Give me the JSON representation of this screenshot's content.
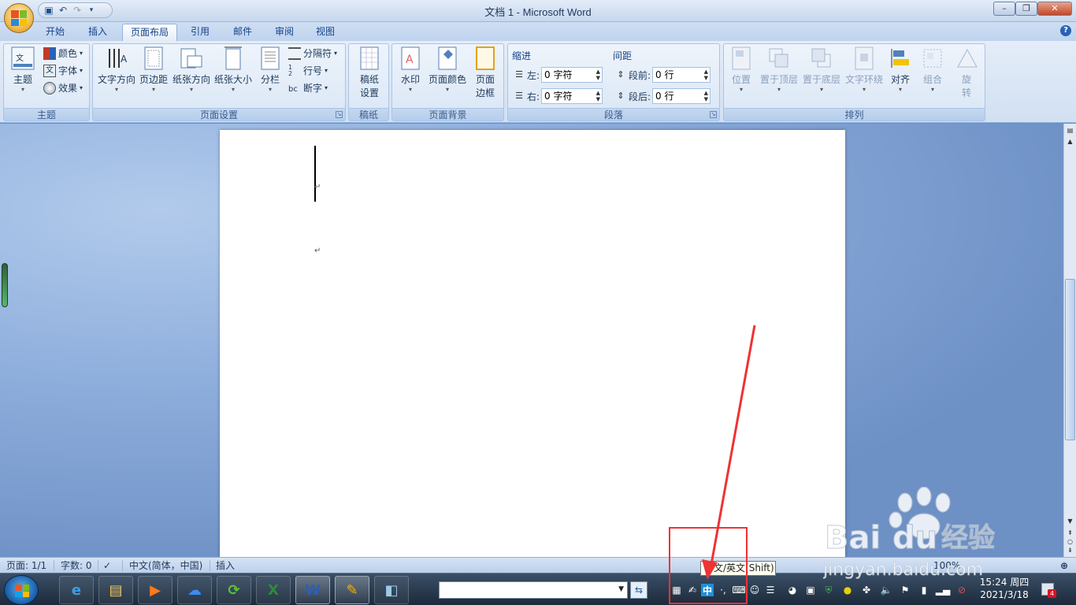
{
  "window": {
    "title": "文档 1 - Microsoft Word",
    "controls": [
      "–",
      "❐",
      "✕"
    ]
  },
  "qat": {
    "icons": [
      "save-icon",
      "undo-icon",
      "redo-icon",
      "customize-icon"
    ]
  },
  "tabs": [
    {
      "label": "开始",
      "active": false
    },
    {
      "label": "插入",
      "active": false
    },
    {
      "label": "页面布局",
      "active": true
    },
    {
      "label": "引用",
      "active": false
    },
    {
      "label": "邮件",
      "active": false
    },
    {
      "label": "审阅",
      "active": false
    },
    {
      "label": "视图",
      "active": false
    }
  ],
  "help": "?",
  "ribbon": {
    "theme": {
      "label": "主题",
      "big": "主题",
      "colors": "颜色",
      "fonts": "字体",
      "effects": "效果"
    },
    "page_setup": {
      "label": "页面设置",
      "buttons": [
        "文字方向",
        "页边距",
        "纸张方向",
        "纸张大小",
        "分栏"
      ],
      "breaks": "分隔符",
      "line_numbers": "行号",
      "hyphenation": "断字"
    },
    "manuscript": {
      "label": "稿纸",
      "button_line1": "稿纸",
      "button_line2": "设置"
    },
    "page_background": {
      "label": "页面背景",
      "watermark": "水印",
      "page_color": "页面颜色",
      "border_line1": "页面",
      "border_line2": "边框"
    },
    "paragraph": {
      "label": "段落",
      "indent_title": "缩进",
      "spacing_title": "间距",
      "indent_left_label": "左:",
      "indent_left_value": "0 字符",
      "indent_right_label": "右:",
      "indent_right_value": "0 字符",
      "spacing_before_label": "段前:",
      "spacing_before_value": "0 行",
      "spacing_after_label": "段后:",
      "spacing_after_value": "0 行"
    },
    "arrange": {
      "label": "排列",
      "buttons": [
        "位置",
        "置于顶层",
        "置于底层",
        "文字环绕",
        "对齐",
        "组合"
      ],
      "rotate_line1": "旋",
      "rotate_line2": "转"
    }
  },
  "statusbar": {
    "page": "页面: 1/1",
    "words": "字数: 0",
    "language": "中文(简体，中国)",
    "mode": "插入",
    "zoom": "100%"
  },
  "taskbar": {
    "apps": [
      {
        "name": "internet-explorer",
        "glyph": "e",
        "color": "#3aa0e6",
        "running": false
      },
      {
        "name": "file-explorer",
        "glyph": "▤",
        "color": "#f2c760",
        "running": false
      },
      {
        "name": "media-player",
        "glyph": "▶",
        "color": "#ff7a1a",
        "running": false
      },
      {
        "name": "baidu-netdisk",
        "glyph": "☁",
        "color": "#3b8cf5",
        "running": false
      },
      {
        "name": "browser-360",
        "glyph": "⟳",
        "color": "#5bc236",
        "running": false
      },
      {
        "name": "excel",
        "glyph": "X",
        "color": "#2e8b3c",
        "running": false
      },
      {
        "name": "word",
        "glyph": "W",
        "color": "#2b5fb4",
        "running": true
      },
      {
        "name": "note-pen",
        "glyph": "✎",
        "color": "#f5b400",
        "running": true
      },
      {
        "name": "glass-app",
        "glyph": "◧",
        "color": "#9ec9e8",
        "running": false
      }
    ],
    "ime_mode_glyph": "中",
    "clock_time": "15:24 周四",
    "clock_date": "2021/3/18",
    "notify_count": "4"
  },
  "annotation": {
    "tooltip": "中文/英文(Shift)",
    "highlight_color": "#ee3333"
  },
  "watermark": {
    "brand": "Bai",
    "brand2": "du",
    "cn": "经验",
    "url": "jingyan.baidu.com"
  },
  "colors": {
    "ribbon_bg": "#dbe7f6",
    "workspace": "#8eaedc",
    "accent": "#15428b"
  }
}
